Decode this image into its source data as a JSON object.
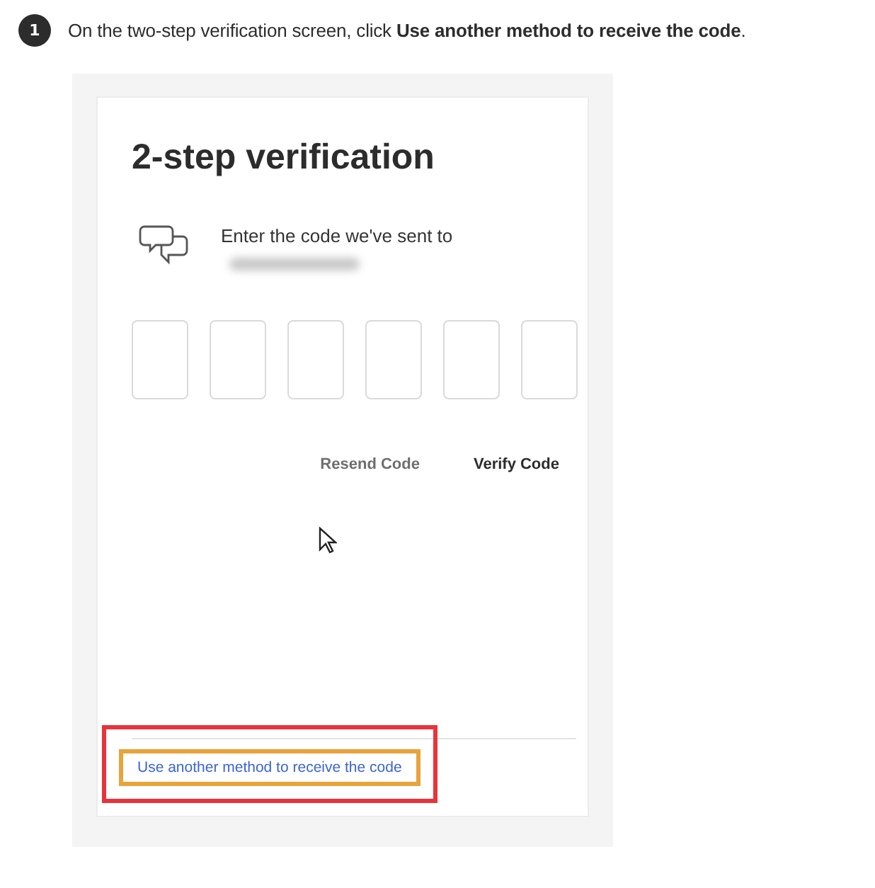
{
  "step": {
    "number": "1",
    "text": "On the two-step verification screen, click **Use another method to receive the code**."
  },
  "screen": {
    "title": "2-step verification",
    "message": "Enter the code we've sent to",
    "recipient_redacted": true,
    "code_fields": [
      {
        "filled": false
      },
      {
        "filled": false
      },
      {
        "filled": false
      },
      {
        "filled": false
      },
      {
        "filled": false
      },
      {
        "filled": false
      }
    ],
    "buttons": [
      {
        "label": "Resend Code",
        "kind": "secondary"
      },
      {
        "label": "Verify Code",
        "kind": "primary"
      }
    ],
    "alternate_link": {
      "label": "Use another method to receive the code",
      "highlighted": true
    }
  }
}
